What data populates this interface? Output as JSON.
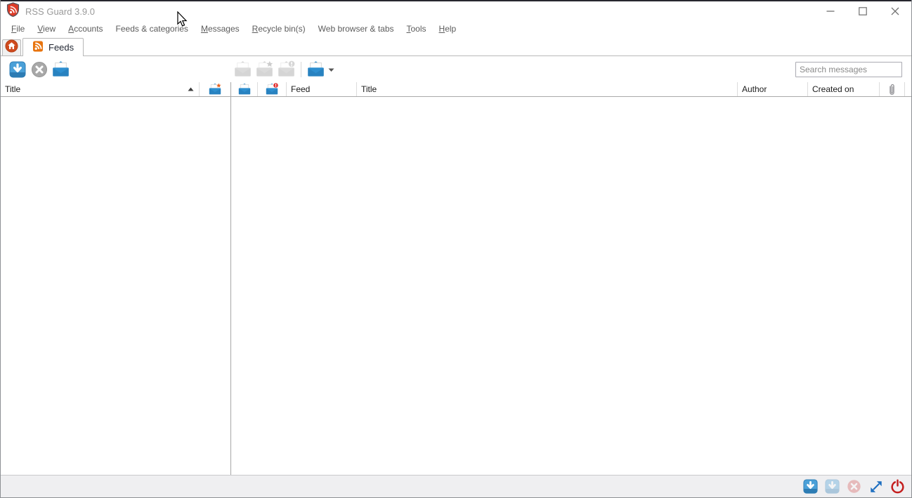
{
  "window": {
    "title": "RSS Guard 3.9.0"
  },
  "menubar": {
    "items": [
      {
        "label": "File",
        "mnemonic": 0
      },
      {
        "label": "View",
        "mnemonic": 0
      },
      {
        "label": "Accounts",
        "mnemonic": 0
      },
      {
        "label": "Feeds & categories",
        "mnemonic": -1
      },
      {
        "label": "Messages",
        "mnemonic": 0
      },
      {
        "label": "Recycle bin(s)",
        "mnemonic": 0
      },
      {
        "label": "Web browser & tabs",
        "mnemonic": -1
      },
      {
        "label": "Tools",
        "mnemonic": 0
      },
      {
        "label": "Help",
        "mnemonic": 0
      }
    ]
  },
  "tabs": {
    "feeds_label": "Feeds"
  },
  "toolbar": {
    "search_placeholder": "Search messages"
  },
  "feeds_list": {
    "title_column": "Title",
    "sort_order": "ascending"
  },
  "messages_list": {
    "columns": [
      {
        "icon": "read-icon"
      },
      {
        "icon": "importance-icon"
      },
      {
        "label": "Feed"
      },
      {
        "label": "Title"
      },
      {
        "label": "Author"
      },
      {
        "label": "Created on"
      },
      {
        "icon": "attachment-icon"
      }
    ]
  },
  "icons": {
    "app-logo": "rss-shield",
    "home-tab": "home",
    "feeds-tab": "rss",
    "update-feeds": "arrow-down-square",
    "stop-update": "x-circle",
    "mark-all-read": "open-envelope",
    "mark-read-unread": "envelope-gray",
    "mark-important": "envelope-star-gray",
    "delete-message": "envelope-exclamation-gray",
    "mark-selection-read": "open-envelope-dropdown",
    "feed-counts": "envelope-orange-star",
    "message-read": "open-envelope-blue",
    "message-importance": "envelope-red-badge",
    "attachment": "paperclip",
    "sort": "triangle-up",
    "fullscreen": "diagonal-arrows",
    "quit": "power"
  },
  "colors": {
    "accent_blue": "#2e8fd0",
    "accent_orange": "#e8740f",
    "danger_red": "#c41e1e",
    "disabled_gray": "#a6a6a6"
  }
}
